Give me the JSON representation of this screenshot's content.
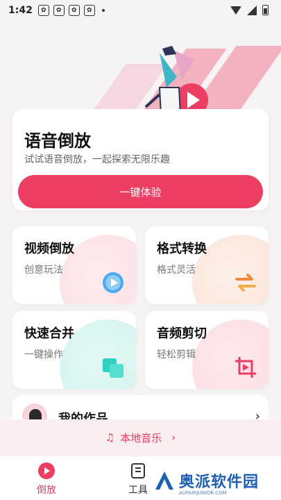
{
  "status_bar": {
    "time": "1:42"
  },
  "hero": {
    "title": "语音倒放",
    "subtitle": "试试语音倒放，一起探索无限乐趣",
    "cta_label": "一键体验"
  },
  "features": [
    {
      "title": "视频倒放",
      "subtitle": "创意玩法",
      "icon": "play-reverse-icon",
      "accent": "#4aa8f0"
    },
    {
      "title": "格式转换",
      "subtitle": "格式灵活",
      "icon": "swap-arrows-icon",
      "accent": "#f2883a"
    },
    {
      "title": "快速合并",
      "subtitle": "一键操作",
      "icon": "merge-squares-icon",
      "accent": "#2fcfc2"
    },
    {
      "title": "音频剪切",
      "subtitle": "轻松剪辑",
      "icon": "crop-play-icon",
      "accent": "#ec3d63"
    }
  ],
  "works": {
    "title": "我的作品",
    "chevron": "›"
  },
  "local_music": {
    "label": "本地音乐",
    "chevron": "›"
  },
  "bottom_nav": {
    "items": [
      {
        "label": "倒放",
        "icon": "play-circle-icon",
        "active": true
      },
      {
        "label": "工具",
        "icon": "toolbox-icon",
        "active": false
      }
    ]
  },
  "watermark": {
    "text": "奥派软件园",
    "small_text": "AUPAIRJUNIOR.COM"
  },
  "colors": {
    "accent": "#ec3d63",
    "background": "#f6f3f4"
  }
}
